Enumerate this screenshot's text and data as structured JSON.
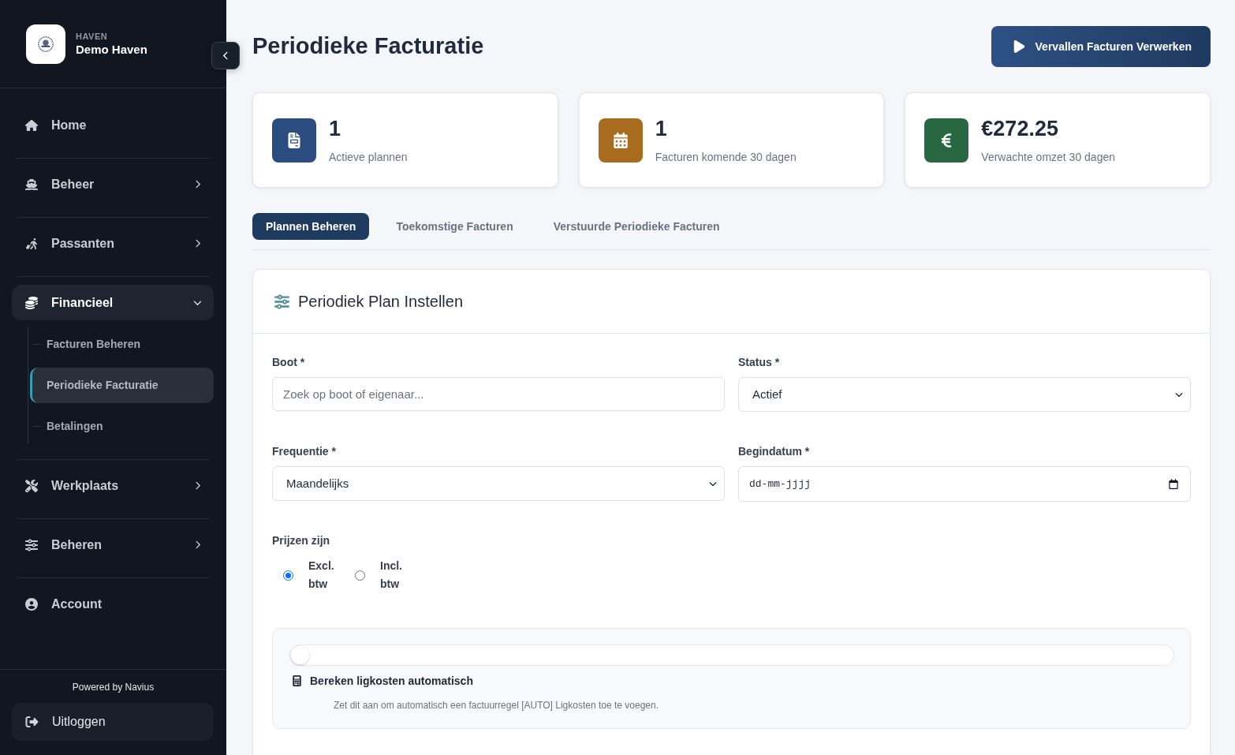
{
  "sidebar": {
    "brand": {
      "kicker": "HAVEN",
      "name": "Demo Haven"
    },
    "items": [
      {
        "kind": "link",
        "label": "Home"
      },
      {
        "kind": "group",
        "label": "Beheer",
        "expanded": false
      },
      {
        "kind": "group",
        "label": "Passanten",
        "expanded": false
      },
      {
        "kind": "group",
        "label": "Financieel",
        "expanded": true,
        "children": [
          {
            "label": "Facturen Beheren",
            "selected": false
          },
          {
            "label": "Periodieke Facturatie",
            "selected": true
          },
          {
            "label": "Betalingen",
            "selected": false
          }
        ]
      },
      {
        "kind": "group",
        "label": "Werkplaats",
        "expanded": false
      },
      {
        "kind": "group",
        "label": "Beheren",
        "expanded": false
      },
      {
        "kind": "link",
        "label": "Account"
      }
    ],
    "footer": {
      "powered_by": "Powered by Navius",
      "logout": "Uitloggen"
    }
  },
  "header": {
    "title": "Periodieke Facturatie",
    "action": "Vervallen Facturen Verwerken"
  },
  "stats": [
    {
      "value": "1",
      "label": "Actieve plannen",
      "color": "#2b4c7e"
    },
    {
      "value": "1",
      "label": "Facturen komende 30 dagen",
      "color": "#a86c1e"
    },
    {
      "value": "€272.25",
      "label": "Verwachte omzet 30 dagen",
      "color": "#276842"
    }
  ],
  "tabs": [
    {
      "label": "Plannen Beheren",
      "selected": true
    },
    {
      "label": "Toekomstige Facturen",
      "selected": false
    },
    {
      "label": "Verstuurde Periodieke Facturen",
      "selected": false
    }
  ],
  "form": {
    "title": "Periodiek Plan Instellen",
    "fields": [
      {
        "kind": "text",
        "label": "Boot *",
        "placeholder": "Zoek op boot of eigenaar..."
      },
      {
        "kind": "select",
        "label": "Status *",
        "value": "Actief"
      },
      {
        "kind": "select",
        "label": "Frequentie *",
        "value": "Maandelijks"
      },
      {
        "kind": "date",
        "label": "Begindatum *",
        "placeholder": "dd-mm-jjjj"
      }
    ],
    "price_mode": {
      "label": "Prijzen zijn",
      "options": [
        {
          "label": "Excl. btw",
          "selected": true
        },
        {
          "label": "Incl. btw",
          "selected": false
        }
      ]
    },
    "auto_berth": {
      "on": false,
      "title": "Bereken ligkosten automatisch",
      "description": "Zet dit aan om automatisch een factuurregel [AUTO] Ligkosten toe te voegen."
    }
  }
}
